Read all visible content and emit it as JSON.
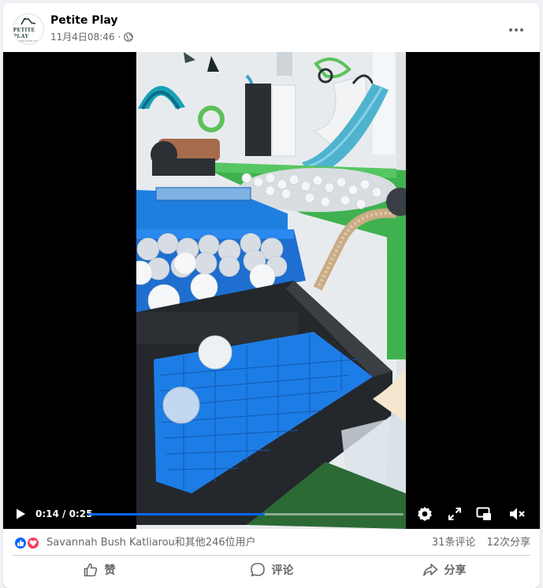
{
  "post": {
    "page_name": "Petite Play",
    "timestamp": "11月4日08:46",
    "separator": "·",
    "privacy_icon": "globe-icon",
    "more_icon": "more-options-icon",
    "avatar": {
      "logo_text": "PETITE PLAY",
      "logo_subtext": "GROW WITH PLAY"
    }
  },
  "video": {
    "current_time": "0:14",
    "duration": "0:25",
    "time_display": "0:14 / 0:25",
    "progress": 0.56,
    "icons": [
      "play-icon",
      "settings-icon",
      "fullscreen-icon",
      "picture-in-picture-icon",
      "volume-muted-icon"
    ],
    "accent_color": "#0866ff"
  },
  "reactions": {
    "icons": [
      "like-reaction-icon",
      "love-reaction-icon"
    ],
    "names_text": "Savannah Bush Katliarou和其他246位用户",
    "comments": "31条评论",
    "shares": "12次分享"
  },
  "actions": {
    "like_label": "赞",
    "comment_label": "评论",
    "share_label": "分享"
  }
}
